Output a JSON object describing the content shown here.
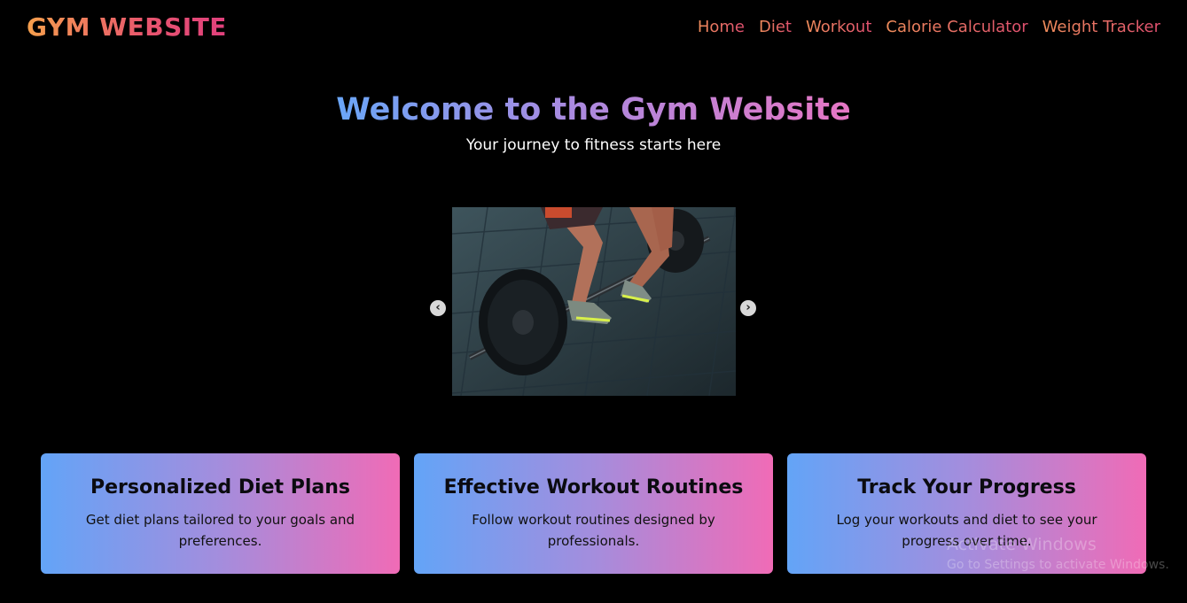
{
  "header": {
    "logo": "GYM WEBSITE",
    "nav": [
      "Home",
      "Diet",
      "Workout",
      "Calorie Calculator",
      "Weight Tracker"
    ]
  },
  "hero": {
    "title": "Welcome to the Gym Website",
    "subtitle": "Your journey to fitness starts here"
  },
  "carousel": {
    "prev_icon": "chevron-left-icon",
    "next_icon": "chevron-right-icon"
  },
  "cards": [
    {
      "title": "Personalized Diet Plans",
      "text": "Get diet plans tailored to your goals and preferences."
    },
    {
      "title": "Effective Workout Routines",
      "text": "Follow workout routines designed by professionals."
    },
    {
      "title": "Track Your Progress",
      "text": "Log your workouts and diet to see your progress over time."
    }
  ],
  "watermark": {
    "line1": "Activate Windows",
    "line2": "Go to Settings to activate Windows."
  },
  "colors": {
    "background": "#000000",
    "logo_gradient": [
      "#f6a04d",
      "#e0407d"
    ],
    "title_gradient": [
      "#6aa6f8",
      "#e676c4"
    ],
    "card_gradient": [
      "#63a4f7",
      "#f06bb6"
    ]
  }
}
